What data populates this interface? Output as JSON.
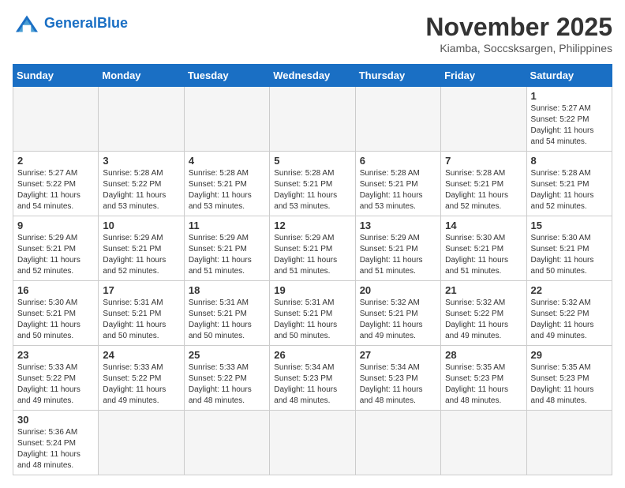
{
  "logo": {
    "text_general": "General",
    "text_blue": "Blue"
  },
  "title": "November 2025",
  "location": "Kiamba, Soccsksargen, Philippines",
  "weekdays": [
    "Sunday",
    "Monday",
    "Tuesday",
    "Wednesday",
    "Thursday",
    "Friday",
    "Saturday"
  ],
  "days": [
    {
      "num": "",
      "info": ""
    },
    {
      "num": "",
      "info": ""
    },
    {
      "num": "",
      "info": ""
    },
    {
      "num": "",
      "info": ""
    },
    {
      "num": "",
      "info": ""
    },
    {
      "num": "",
      "info": ""
    },
    {
      "num": "1",
      "info": "Sunrise: 5:27 AM\nSunset: 5:22 PM\nDaylight: 11 hours\nand 54 minutes."
    },
    {
      "num": "2",
      "info": "Sunrise: 5:27 AM\nSunset: 5:22 PM\nDaylight: 11 hours\nand 54 minutes."
    },
    {
      "num": "3",
      "info": "Sunrise: 5:28 AM\nSunset: 5:22 PM\nDaylight: 11 hours\nand 53 minutes."
    },
    {
      "num": "4",
      "info": "Sunrise: 5:28 AM\nSunset: 5:21 PM\nDaylight: 11 hours\nand 53 minutes."
    },
    {
      "num": "5",
      "info": "Sunrise: 5:28 AM\nSunset: 5:21 PM\nDaylight: 11 hours\nand 53 minutes."
    },
    {
      "num": "6",
      "info": "Sunrise: 5:28 AM\nSunset: 5:21 PM\nDaylight: 11 hours\nand 53 minutes."
    },
    {
      "num": "7",
      "info": "Sunrise: 5:28 AM\nSunset: 5:21 PM\nDaylight: 11 hours\nand 52 minutes."
    },
    {
      "num": "8",
      "info": "Sunrise: 5:28 AM\nSunset: 5:21 PM\nDaylight: 11 hours\nand 52 minutes."
    },
    {
      "num": "9",
      "info": "Sunrise: 5:29 AM\nSunset: 5:21 PM\nDaylight: 11 hours\nand 52 minutes."
    },
    {
      "num": "10",
      "info": "Sunrise: 5:29 AM\nSunset: 5:21 PM\nDaylight: 11 hours\nand 52 minutes."
    },
    {
      "num": "11",
      "info": "Sunrise: 5:29 AM\nSunset: 5:21 PM\nDaylight: 11 hours\nand 51 minutes."
    },
    {
      "num": "12",
      "info": "Sunrise: 5:29 AM\nSunset: 5:21 PM\nDaylight: 11 hours\nand 51 minutes."
    },
    {
      "num": "13",
      "info": "Sunrise: 5:29 AM\nSunset: 5:21 PM\nDaylight: 11 hours\nand 51 minutes."
    },
    {
      "num": "14",
      "info": "Sunrise: 5:30 AM\nSunset: 5:21 PM\nDaylight: 11 hours\nand 51 minutes."
    },
    {
      "num": "15",
      "info": "Sunrise: 5:30 AM\nSunset: 5:21 PM\nDaylight: 11 hours\nand 50 minutes."
    },
    {
      "num": "16",
      "info": "Sunrise: 5:30 AM\nSunset: 5:21 PM\nDaylight: 11 hours\nand 50 minutes."
    },
    {
      "num": "17",
      "info": "Sunrise: 5:31 AM\nSunset: 5:21 PM\nDaylight: 11 hours\nand 50 minutes."
    },
    {
      "num": "18",
      "info": "Sunrise: 5:31 AM\nSunset: 5:21 PM\nDaylight: 11 hours\nand 50 minutes."
    },
    {
      "num": "19",
      "info": "Sunrise: 5:31 AM\nSunset: 5:21 PM\nDaylight: 11 hours\nand 50 minutes."
    },
    {
      "num": "20",
      "info": "Sunrise: 5:32 AM\nSunset: 5:21 PM\nDaylight: 11 hours\nand 49 minutes."
    },
    {
      "num": "21",
      "info": "Sunrise: 5:32 AM\nSunset: 5:22 PM\nDaylight: 11 hours\nand 49 minutes."
    },
    {
      "num": "22",
      "info": "Sunrise: 5:32 AM\nSunset: 5:22 PM\nDaylight: 11 hours\nand 49 minutes."
    },
    {
      "num": "23",
      "info": "Sunrise: 5:33 AM\nSunset: 5:22 PM\nDaylight: 11 hours\nand 49 minutes."
    },
    {
      "num": "24",
      "info": "Sunrise: 5:33 AM\nSunset: 5:22 PM\nDaylight: 11 hours\nand 49 minutes."
    },
    {
      "num": "25",
      "info": "Sunrise: 5:33 AM\nSunset: 5:22 PM\nDaylight: 11 hours\nand 48 minutes."
    },
    {
      "num": "26",
      "info": "Sunrise: 5:34 AM\nSunset: 5:23 PM\nDaylight: 11 hours\nand 48 minutes."
    },
    {
      "num": "27",
      "info": "Sunrise: 5:34 AM\nSunset: 5:23 PM\nDaylight: 11 hours\nand 48 minutes."
    },
    {
      "num": "28",
      "info": "Sunrise: 5:35 AM\nSunset: 5:23 PM\nDaylight: 11 hours\nand 48 minutes."
    },
    {
      "num": "29",
      "info": "Sunrise: 5:35 AM\nSunset: 5:23 PM\nDaylight: 11 hours\nand 48 minutes."
    },
    {
      "num": "30",
      "info": "Sunrise: 5:36 AM\nSunset: 5:24 PM\nDaylight: 11 hours\nand 48 minutes."
    },
    {
      "num": "",
      "info": ""
    },
    {
      "num": "",
      "info": ""
    },
    {
      "num": "",
      "info": ""
    },
    {
      "num": "",
      "info": ""
    },
    {
      "num": "",
      "info": ""
    },
    {
      "num": "",
      "info": ""
    }
  ]
}
